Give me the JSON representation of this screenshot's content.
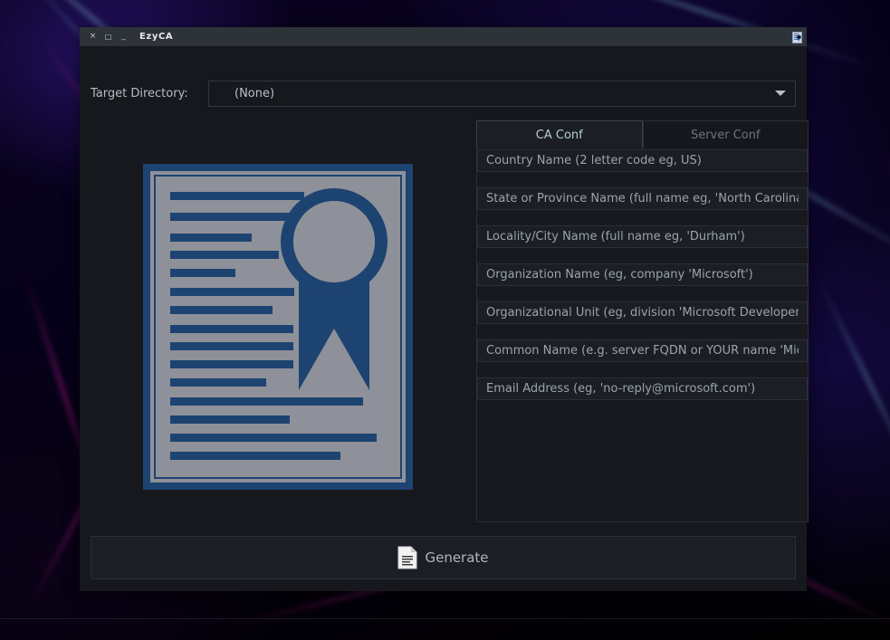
{
  "window": {
    "title": "EzyCA",
    "titlebar_buttons": [
      {
        "name": "close",
        "glyph": "×"
      },
      {
        "name": "maximize",
        "glyph": "□"
      },
      {
        "name": "minimize",
        "glyph": "_"
      }
    ],
    "app_icon": "certificate-app-icon"
  },
  "target_directory": {
    "label": "Target Directory:",
    "value": "(None)",
    "dropdown_icon": "chevron-down-icon"
  },
  "preview": {
    "icon": "certificate-illustration",
    "colors": {
      "paper": "#8e9199",
      "ink": "#1d4371"
    }
  },
  "tabs": [
    {
      "id": "ca-conf",
      "label": "CA Conf",
      "active": true
    },
    {
      "id": "server-conf",
      "label": "Server Conf",
      "active": false
    }
  ],
  "fields": [
    {
      "id": "country-name",
      "placeholder": "Country Name (2 letter code eg, US)",
      "value": ""
    },
    {
      "id": "state-province",
      "placeholder": "State or Province Name (full name eg, 'North Carolina')",
      "value": ""
    },
    {
      "id": "locality-city",
      "placeholder": "Locality/City Name (full name eg, 'Durham')",
      "value": ""
    },
    {
      "id": "organization-name",
      "placeholder": "Organization Name (eg, company 'Microsoft')",
      "value": ""
    },
    {
      "id": "organizational-unit",
      "placeholder": "Organizational Unit (eg, division 'Microsoft Developent')",
      "value": ""
    },
    {
      "id": "common-name",
      "placeholder": "Common Name (e.g. server FQDN or YOUR name 'Microsoft CA')",
      "value": ""
    },
    {
      "id": "email-address",
      "placeholder": "Email Address (eg, 'no-reply@microsoft.com')",
      "value": ""
    }
  ],
  "generate": {
    "label": "Generate",
    "icon": "document-icon"
  },
  "theme": {
    "window_bg": "#16181d",
    "titlebar_bg": "#2e3239",
    "field_bg": "#1b1e24",
    "border": "#2b2f36",
    "text": "#b2bdc0",
    "muted_text": "#6d757f",
    "accent_text": "#b7d0d4"
  }
}
